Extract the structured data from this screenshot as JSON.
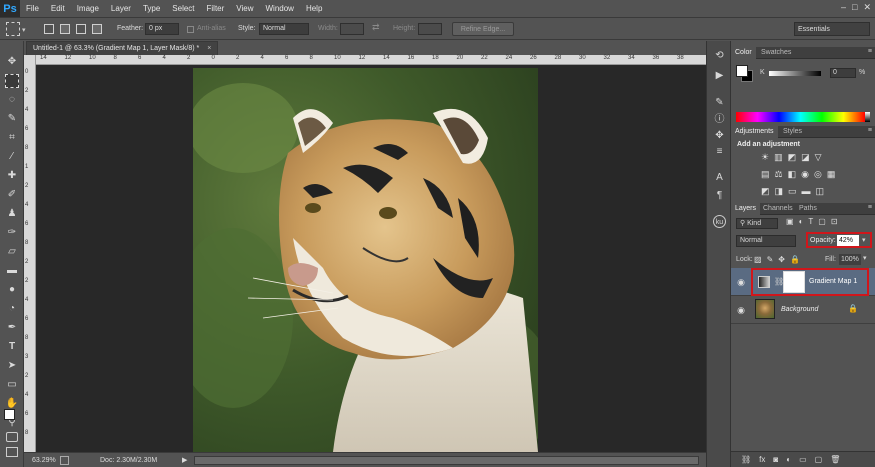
{
  "menu": {
    "logo": "Ps",
    "items": [
      "File",
      "Edit",
      "Image",
      "Layer",
      "Type",
      "Select",
      "Filter",
      "View",
      "Window",
      "Help"
    ],
    "window_controls": [
      "–",
      "□",
      "✕"
    ]
  },
  "options": {
    "feather_label": "Feather:",
    "feather_value": "0 px",
    "antialias_label": "Anti-alias",
    "style_label": "Style:",
    "style_value": "Normal",
    "width_label": "Width:",
    "height_label": "Height:",
    "refine_edge": "Refine Edge...",
    "workspace": "Essentials"
  },
  "document": {
    "tab_title": "Untitled-1 @ 63.3% (Gradient Map 1, Layer Mask/8) *",
    "zoom": "63.29%",
    "doc_size": "Doc: 2.30M/2.30M"
  },
  "rulers": {
    "top": [
      "14",
      "12",
      "10",
      "8",
      "6",
      "4",
      "2",
      "0",
      "2",
      "4",
      "6",
      "8",
      "10",
      "12",
      "14",
      "16",
      "18",
      "20",
      "22",
      "24",
      "26",
      "28",
      "30",
      "32",
      "34",
      "36",
      "38"
    ],
    "left": [
      "0",
      "2",
      "4",
      "6",
      "8",
      "1",
      "2",
      "4",
      "6",
      "8",
      "2",
      "2",
      "4",
      "6",
      "8",
      "3",
      "2",
      "4",
      "6",
      "8"
    ]
  },
  "color_panel": {
    "tabs": [
      "Color",
      "Swatches"
    ],
    "channel_label": "K",
    "value": "0",
    "unit": "%"
  },
  "adjustments_panel": {
    "tabs": [
      "Adjustments",
      "Styles"
    ],
    "heading": "Add an adjustment"
  },
  "layers_panel": {
    "tabs": [
      "Layers",
      "Channels",
      "Paths"
    ],
    "filter_kind": "Kind",
    "blend_mode": "Normal",
    "opacity_label": "Opacity:",
    "opacity_value": "42%",
    "lock_label": "Lock:",
    "fill_label": "Fill:",
    "fill_value": "100%",
    "layers": [
      {
        "name": "Gradient Map 1"
      },
      {
        "name": "Background"
      }
    ],
    "footer_icons": [
      "link-icon",
      "fx-icon",
      "mask-icon",
      "adjustment-icon",
      "group-icon",
      "new-layer-icon",
      "trash-icon"
    ]
  },
  "colors": {
    "highlight": "#d0161b",
    "selected_layer": "#5a6b82",
    "spectrum_start": "#ff0000"
  }
}
